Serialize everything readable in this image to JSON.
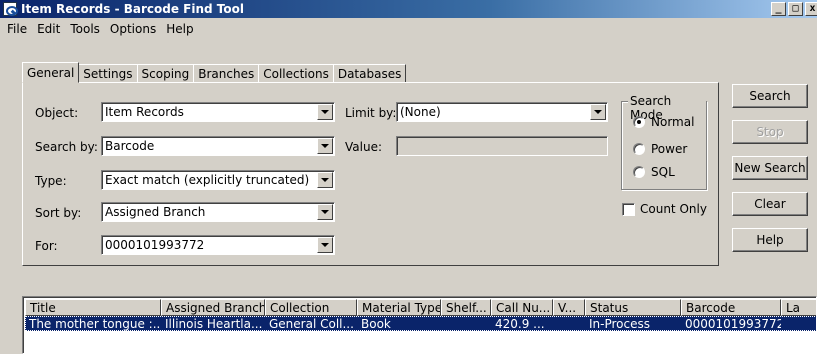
{
  "window": {
    "title": "Item Records - Barcode Find Tool",
    "controls": [
      "_",
      "□",
      "x"
    ]
  },
  "menu": [
    "File",
    "Edit",
    "Tools",
    "Options",
    "Help"
  ],
  "tabs": [
    "General",
    "Settings",
    "Scoping",
    "Branches",
    "Collections",
    "Databases"
  ],
  "active_tab": "General",
  "form": {
    "object_label": "Object:",
    "object_value": "Item Records",
    "search_by_label": "Search by:",
    "search_by_value": "Barcode",
    "type_label": "Type:",
    "type_value": "Exact match (explicitly truncated)",
    "sort_by_label": "Sort by:",
    "sort_by_value": "Assigned Branch",
    "for_label": "For:",
    "for_value": "0000101993772",
    "limit_by_label": "Limit by:",
    "limit_by_value": "(None)",
    "value_label": "Value:",
    "value_value": ""
  },
  "search_mode": {
    "title": "Search Mode",
    "options": [
      "Normal",
      "Power",
      "SQL"
    ],
    "selected": "Normal"
  },
  "count_only": {
    "label": "Count Only",
    "checked": false
  },
  "buttons": {
    "search": "Search",
    "stop": "Stop",
    "new_search": "New Search",
    "clear": "Clear",
    "help": "Help"
  },
  "results": {
    "columns": [
      "Title",
      "Assigned Branch",
      "Collection",
      "Material Type",
      "Shelf...",
      "Call Nu...",
      "V...",
      "Status",
      "Barcode",
      "La"
    ],
    "rows": [
      [
        "The mother tongue :...",
        "Illinois Heartla...",
        "General Coll...",
        "Book",
        "",
        "420.9 ...",
        "",
        "In-Process",
        "0000101993772",
        ""
      ]
    ]
  },
  "colors": {
    "titlebar": "#0a246a",
    "face": "#d4d0c8",
    "selection": "#0a246a"
  }
}
